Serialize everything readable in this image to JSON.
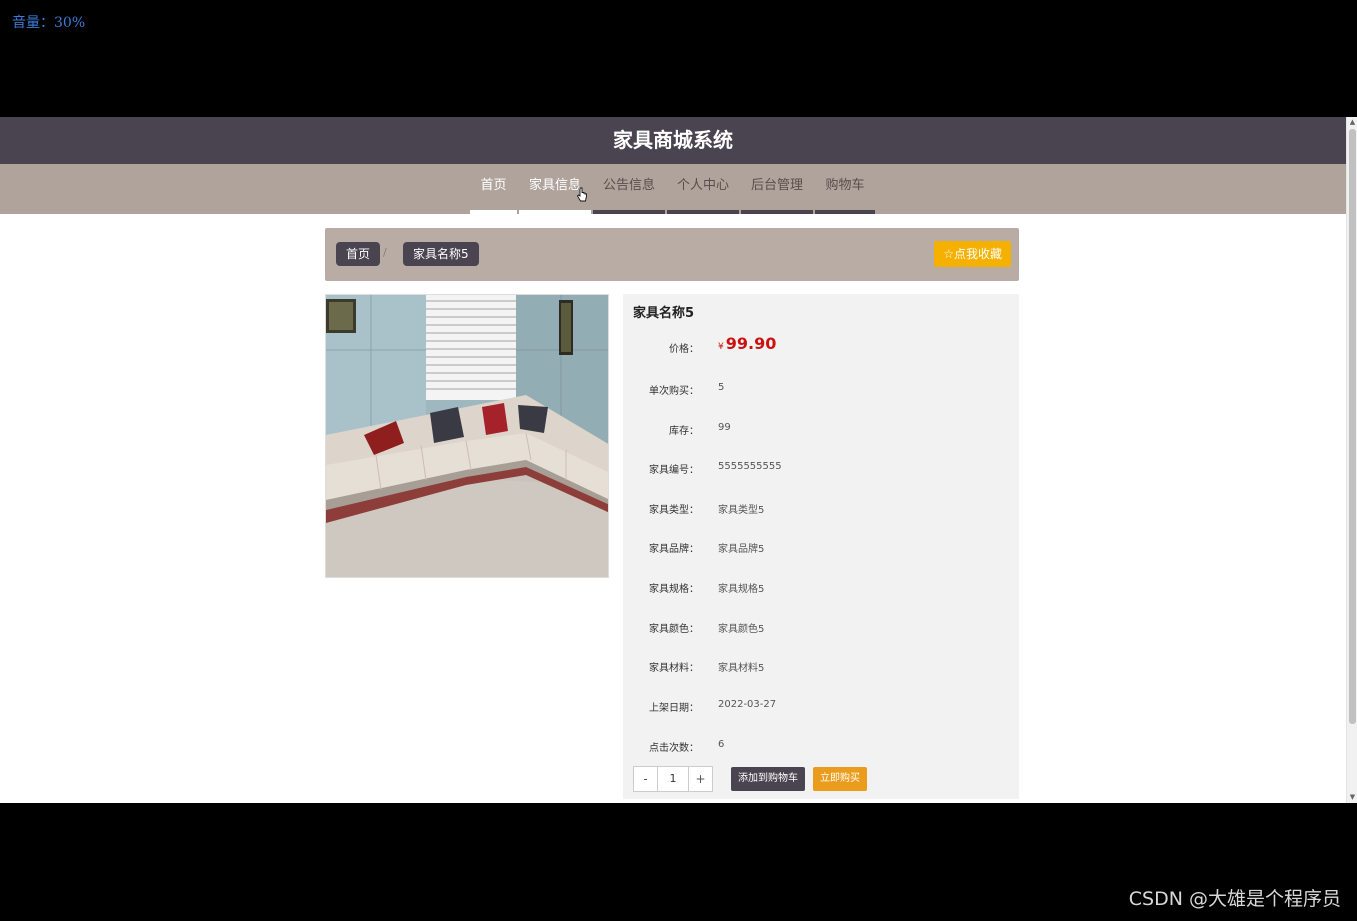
{
  "overlay": {
    "volume": "音量：30%",
    "watermark": "CSDN @大雄是个程序员"
  },
  "header": {
    "title": "家具商城系统"
  },
  "nav": {
    "items": [
      {
        "label": "首页"
      },
      {
        "label": "家具信息"
      },
      {
        "label": "公告信息"
      },
      {
        "label": "个人中心"
      },
      {
        "label": "后台管理"
      },
      {
        "label": "购物车"
      }
    ]
  },
  "breadcrumb": {
    "home": "首页",
    "separator": "/",
    "current": "家具名称5",
    "favorite": "☆点我收藏"
  },
  "product": {
    "name": "家具名称5",
    "price_label": "价格：",
    "currency": "¥",
    "price": "99.90",
    "fields": [
      {
        "label": "单次购买：",
        "value": "5"
      },
      {
        "label": "库存：",
        "value": "99"
      },
      {
        "label": "家具编号：",
        "value": "5555555555"
      },
      {
        "label": "家具类型：",
        "value": "家具类型5"
      },
      {
        "label": "家具品牌：",
        "value": "家具品牌5"
      },
      {
        "label": "家具规格：",
        "value": "家具规格5"
      },
      {
        "label": "家具颜色：",
        "value": "家具颜色5"
      },
      {
        "label": "家具材料：",
        "value": "家具材料5"
      },
      {
        "label": "上架日期：",
        "value": "2022-03-27"
      },
      {
        "label": "点击次数：",
        "value": "6"
      }
    ],
    "quantity": "1",
    "minus": "-",
    "plus": "+",
    "add_to_cart": "添加到购物车",
    "buy_now": "立即购买"
  },
  "colors": {
    "header_bg": "#4a4350",
    "nav_bg": "#b0a39c",
    "accent": "#f5b000",
    "price": "#cc1111"
  }
}
